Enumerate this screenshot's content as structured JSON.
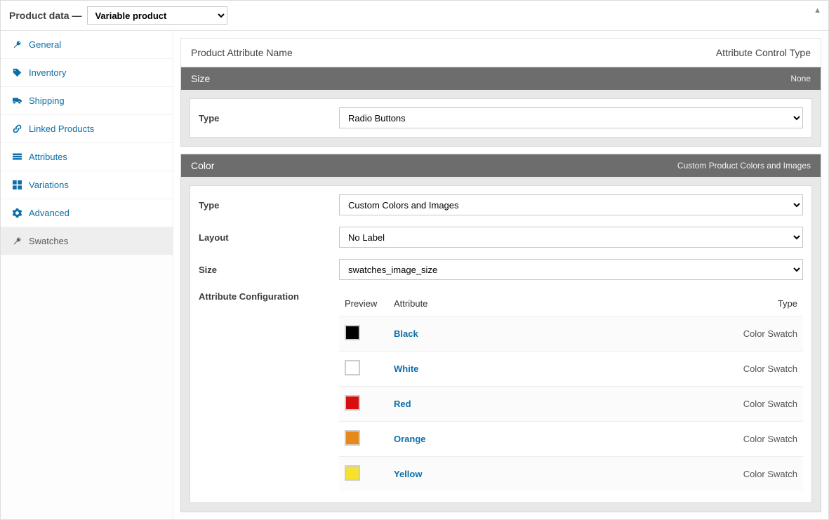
{
  "header": {
    "title": "Product data —",
    "product_type_selected": "Variable product"
  },
  "sidebar": {
    "items": [
      {
        "id": "general",
        "label": "General",
        "icon": "wrench"
      },
      {
        "id": "inventory",
        "label": "Inventory",
        "icon": "link"
      },
      {
        "id": "shipping",
        "label": "Shipping",
        "icon": "truck"
      },
      {
        "id": "linked-products",
        "label": "Linked Products",
        "icon": "link"
      },
      {
        "id": "attributes",
        "label": "Attributes",
        "icon": "list"
      },
      {
        "id": "variations",
        "label": "Variations",
        "icon": "grid"
      },
      {
        "id": "advanced",
        "label": "Advanced",
        "icon": "gear"
      },
      {
        "id": "swatches",
        "label": "Swatches",
        "icon": "wrench",
        "active": true
      }
    ]
  },
  "content": {
    "header_left": "Product Attribute Name",
    "header_right": "Attribute Control Type",
    "attributes": [
      {
        "name": "Size",
        "control_type_label": "None",
        "fields": {
          "type": {
            "label": "Type",
            "value": "Radio Buttons"
          }
        }
      },
      {
        "name": "Color",
        "control_type_label": "Custom Product Colors and Images",
        "fields": {
          "type": {
            "label": "Type",
            "value": "Custom Colors and Images"
          },
          "layout": {
            "label": "Layout",
            "value": "No Label"
          },
          "size": {
            "label": "Size",
            "value": "swatches_image_size"
          },
          "config_label": "Attribute Configuration",
          "table": {
            "headers": {
              "preview": "Preview",
              "attribute": "Attribute",
              "type": "Type"
            },
            "rows": [
              {
                "name": "Black",
                "color": "#000000",
                "type": "Color Swatch"
              },
              {
                "name": "White",
                "color": "#ffffff",
                "type": "Color Swatch"
              },
              {
                "name": "Red",
                "color": "#d90f0f",
                "type": "Color Swatch"
              },
              {
                "name": "Orange",
                "color": "#e58a19",
                "type": "Color Swatch"
              },
              {
                "name": "Yellow",
                "color": "#f6e22d",
                "type": "Color Swatch"
              }
            ]
          }
        }
      }
    ]
  }
}
